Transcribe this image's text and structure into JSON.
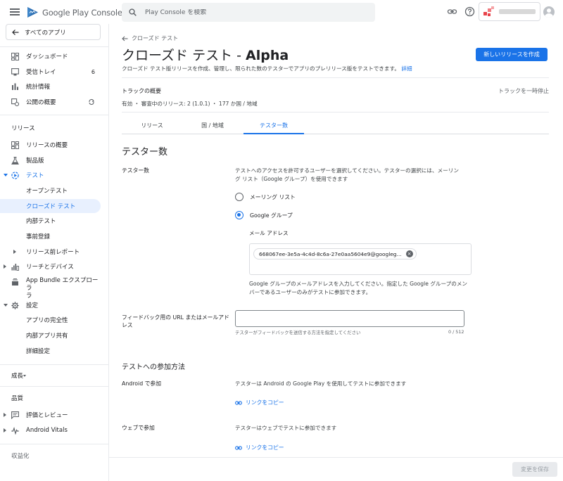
{
  "topbar": {
    "app_title": "Google Play Console",
    "search_placeholder": "Play Console を検索"
  },
  "sidebar": {
    "all_apps": "すべてのアプリ",
    "items": [
      {
        "label": "ダッシュボード",
        "icon": "dashboard-icon"
      },
      {
        "label": "受信トレイ",
        "icon": "inbox-icon",
        "badge": "6"
      },
      {
        "label": "統計情報",
        "icon": "bar-chart-icon"
      },
      {
        "label": "公開の概要",
        "icon": "publishing-overview-icon"
      }
    ],
    "release_section": "リリース",
    "release_items": [
      {
        "label": "リリースの概要",
        "icon": "release-overview-icon"
      },
      {
        "label": "製品版",
        "icon": "production-icon"
      },
      {
        "label": "テスト",
        "icon": "test-icon"
      }
    ],
    "test_subitems": [
      "オープンテスト",
      "クローズド テスト",
      "内部テスト",
      "事前登録"
    ],
    "prelaunch": "リリース前レポート",
    "reach": "リーチとデバイス",
    "bundle_explorer": [
      "App Bundle エクスプローラ",
      "ラ"
    ],
    "settings": "設定",
    "settings_subitems": [
      "アプリの完全性",
      "内部アプリ共有",
      "詳細設定"
    ],
    "growth": "成長",
    "quality": "品質",
    "quality_items": [
      {
        "label": "評価とレビュー",
        "icon": "ratings-icon"
      },
      {
        "label": "Android Vitals",
        "icon": "vitals-icon"
      }
    ],
    "cut_off": "収益化"
  },
  "main": {
    "back_label": "クローズド テスト",
    "title_prefix": "クローズド テスト - ",
    "title_track": "Alpha",
    "new_release_button": "新しいリリースを作成",
    "subtitle": "クローズド テスト版リリースを作成、管理し、限られた数のテスターでアプリのプレリリース版をテストできます。",
    "subtitle_link": "詳細",
    "track_overview": "トラックの概要",
    "pause_track": "トラックを一時停止",
    "track_status": "有効 ・ 審査中のリリース: 2 (1.0.1) ・ 177 か国 / 地域",
    "tabs": [
      "リリース",
      "国 / 地域",
      "テスター数"
    ],
    "testers_heading": "テスター数",
    "testers_label": "テスター数",
    "testers_desc_1": "テストへのアクセスを許可するユーザーを選択してください。テスターの選択には、メーリン",
    "testers_desc_2": "グ リスト（Google グループ）を使用できます",
    "radio_mailing_list": "メーリング リスト",
    "radio_google_group": "Google グループ",
    "email_label": "メール アドレス",
    "email_chip": "668067ee-3e5a-4c4d-8c6a-27e0aa5604e9@googleg...",
    "group_help_1": "Google グループのメールアドレスを入力してください。指定した Google グループのメン",
    "group_help_2": "バーであるユーザーのみがテストに参加できます。",
    "feedback_label_1": "フィードバック用の URL またはメールアド",
    "feedback_label_2": "レス",
    "feedback_helper": "テスターがフィードバックを送信する方法を指定してください",
    "feedback_counter": "0 / 512",
    "join_heading": "テストへの参加方法",
    "android_label": "Android で参加",
    "android_desc": "テスターは Android の Google Play を使用してテストに参加できます",
    "copy_link": "リンクをコピー",
    "web_label": "ウェブで参加",
    "web_desc": "テスターはウェブでテストに参加できます",
    "copy_link_web": "リンクをコピー"
  },
  "footer": {
    "save_button": "変更を保存"
  },
  "colors": {
    "accent": "#1a73e8",
    "selected_bg": "#e8f0fe",
    "divider": "#e8eaed"
  }
}
